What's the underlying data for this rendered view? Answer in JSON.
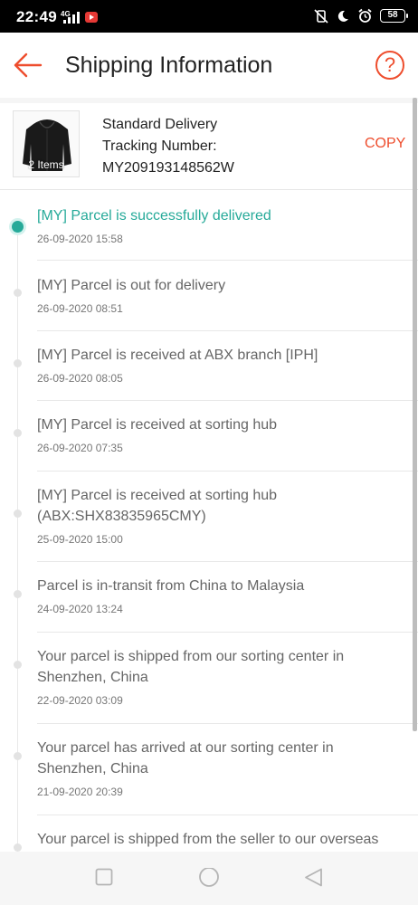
{
  "status_bar": {
    "time": "22:49",
    "network": "4G",
    "battery": "58"
  },
  "header": {
    "title": "Shipping Information",
    "help_symbol": "?"
  },
  "delivery": {
    "thumbnail_label": "2 Items",
    "method": "Standard Delivery",
    "tracking_label": "Tracking Number:",
    "tracking_number": "MY209193148562W",
    "copy_label": "COPY"
  },
  "colors": {
    "accent": "#ee4d2d",
    "delivered": "#26aa99"
  },
  "events": [
    {
      "text": "[MY] Parcel is successfully delivered",
      "time": "26-09-2020 15:58",
      "active": true
    },
    {
      "text": "[MY] Parcel is out for delivery",
      "time": "26-09-2020 08:51",
      "active": false
    },
    {
      "text": "[MY] Parcel is received at ABX branch [IPH]",
      "time": "26-09-2020 08:05",
      "active": false
    },
    {
      "text": "[MY] Parcel is received at sorting hub",
      "time": "26-09-2020 07:35",
      "active": false
    },
    {
      "text": "[MY] Parcel is received at sorting hub (ABX:SHX83835965CMY)",
      "time": "25-09-2020 15:00",
      "active": false
    },
    {
      "text": "Parcel is in-transit from China to Malaysia",
      "time": "24-09-2020 13:24",
      "active": false
    },
    {
      "text": "Your parcel is shipped from our sorting center in Shenzhen, China",
      "time": "22-09-2020 03:09",
      "active": false
    },
    {
      "text": "Your parcel has arrived at our sorting center in Shenzhen, China",
      "time": "21-09-2020 20:39",
      "active": false
    },
    {
      "text": "Your parcel is shipped from the seller to our overseas",
      "time": "",
      "active": false
    }
  ],
  "icons": {
    "back": "arrow-left-icon",
    "help": "help-circle-icon",
    "nav_recents": "square-icon",
    "nav_home": "circle-icon",
    "nav_back": "triangle-back-icon"
  }
}
